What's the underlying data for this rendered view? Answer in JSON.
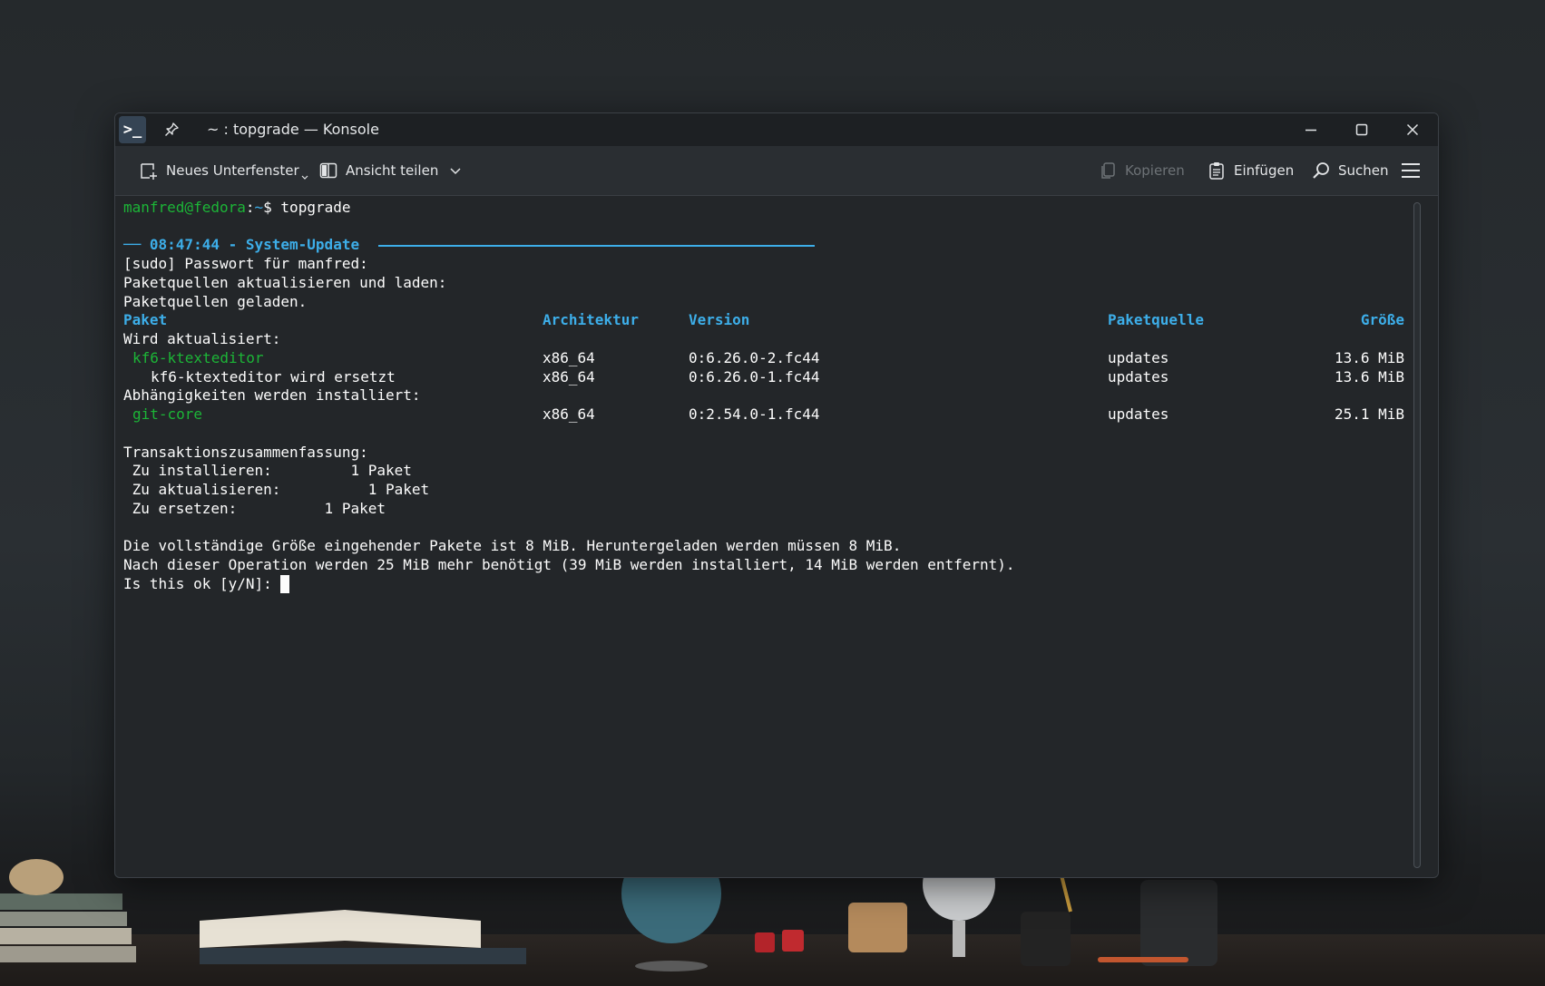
{
  "window": {
    "title": "~ : topgrade — Konsole",
    "app_icon_glyph": ">_"
  },
  "toolbar": {
    "new_tab_label": "Neues Unterfenster",
    "split_view_label": "Ansicht teilen",
    "copy_label": "Kopieren",
    "paste_label": "Einfügen",
    "search_label": "Suchen"
  },
  "terminal": {
    "prompt_user": "manfred@fedora",
    "prompt_sep": ":",
    "prompt_path": "~",
    "prompt_symbol": "$",
    "command": "topgrade",
    "section_header": "── 08:47:44 - System-Update ",
    "sudo_line": "[sudo] Passwort für manfred:",
    "repo_update_line": "Paketquellen aktualisieren und laden:",
    "repo_loaded_line": "Paketquellen geladen.",
    "table_headers": {
      "package": "Paket",
      "arch": "Architektur",
      "version": "Version",
      "repo": "Paketquelle",
      "size": "Größe"
    },
    "upgrading_label": "Wird aktualisiert:",
    "rows": [
      {
        "name": "kf6-ktexteditor",
        "arch": "x86_64",
        "version": "0:6.26.0-2.fc44",
        "repo": "updates",
        "size": "13.6 MiB",
        "highlight": true
      },
      {
        "name": "kf6-ktexteditor wird ersetzt",
        "arch": "x86_64",
        "version": "0:6.26.0-1.fc44",
        "repo": "updates",
        "size": "13.6 MiB",
        "highlight": false
      }
    ],
    "deps_label": "Abhängigkeiten werden installiert:",
    "dep_rows": [
      {
        "name": "git-core",
        "arch": "x86_64",
        "version": "0:2.54.0-1.fc44",
        "repo": "updates",
        "size": "25.1 MiB",
        "highlight": true
      }
    ],
    "summary_title": "Transaktionszusammenfassung:",
    "summary": [
      " Zu installieren:         1 Paket",
      " Zu aktualisieren:          1 Paket",
      " Zu ersetzen:          1 Paket"
    ],
    "size_line_1": "Die vollständige Größe eingehender Pakete ist 8 MiB. Heruntergeladen werden müssen 8 MiB.",
    "size_line_2": "Nach dieser Operation werden 25 MiB mehr benötigt (39 MiB werden installiert, 14 MiB werden entfernt).",
    "confirm_prompt": "Is this ok [y/N]: "
  },
  "colors": {
    "prompt_green": "#1cb537",
    "accent_blue": "#3daee9",
    "terminal_bg": "#232629",
    "text": "#fcfcfc"
  },
  "icons": [
    "terminal-app-icon",
    "pin-icon",
    "minimize-icon",
    "maximize-icon",
    "close-icon",
    "new-tab-icon",
    "split-view-icon",
    "chevron-down-icon",
    "copy-icon",
    "paste-icon",
    "search-icon",
    "hamburger-menu-icon"
  ]
}
